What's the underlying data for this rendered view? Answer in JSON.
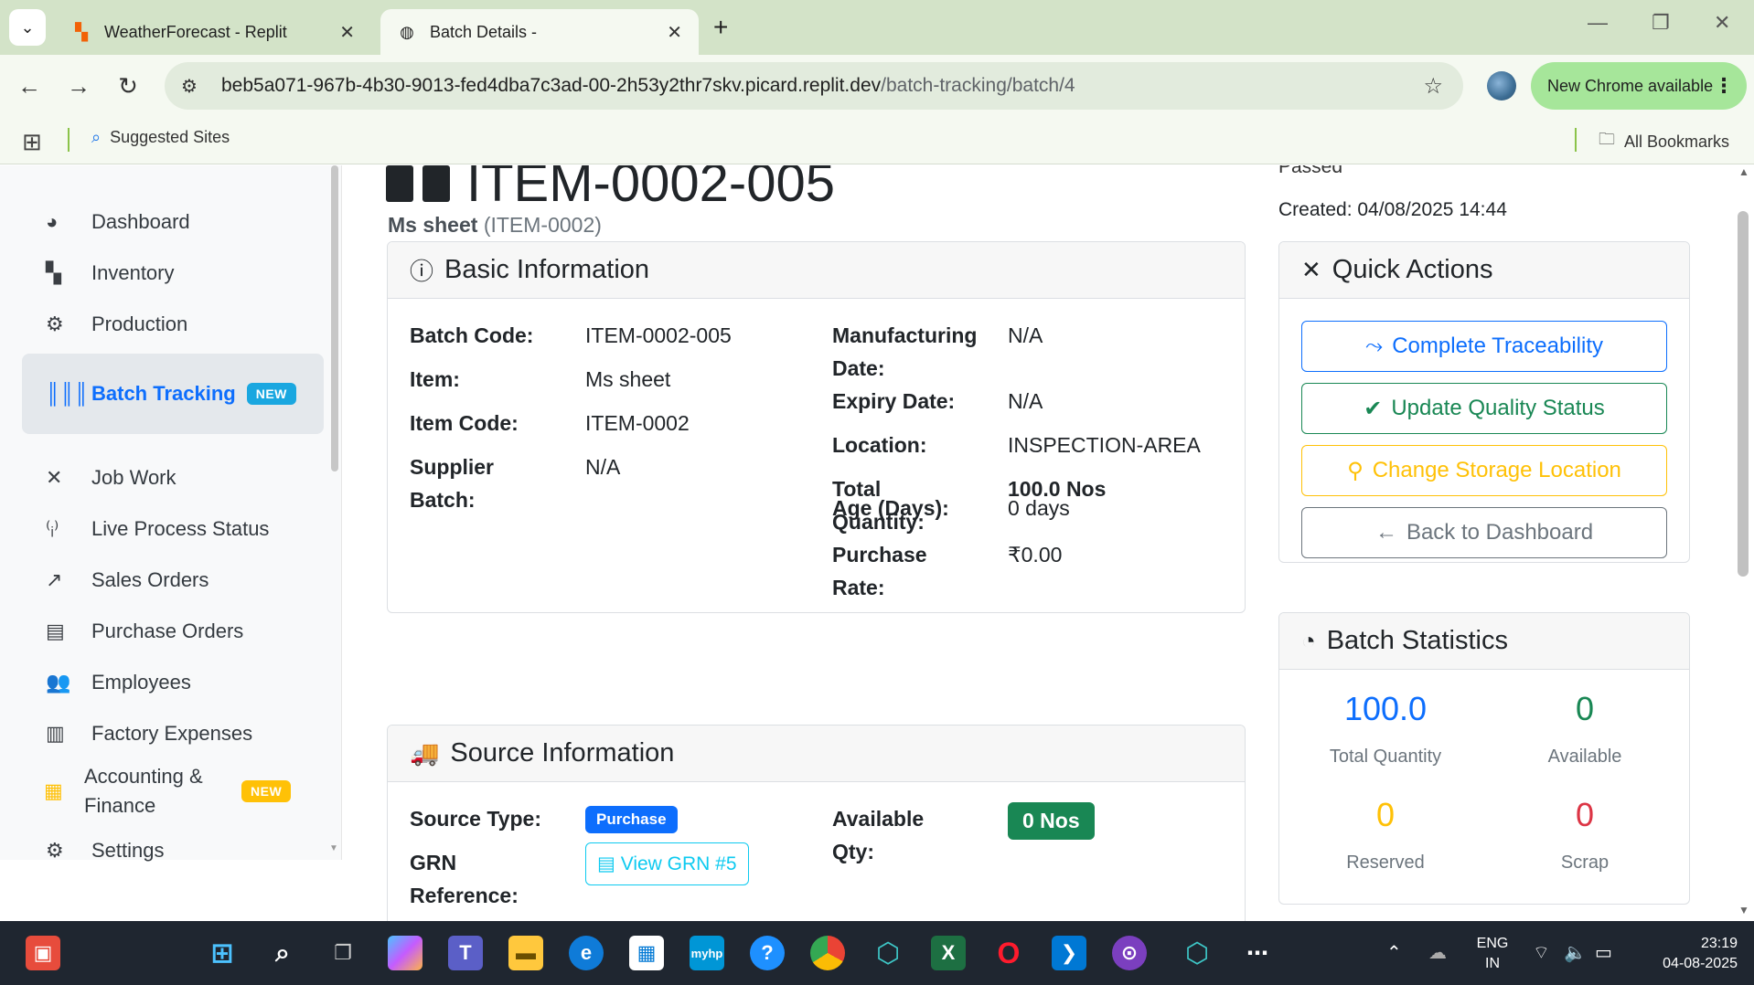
{
  "browser": {
    "tabs": [
      {
        "title": "WeatherForecast - Replit",
        "icon": "replit-icon"
      },
      {
        "title": "Batch Details -",
        "icon": "globe-icon"
      }
    ],
    "url_host": "beb5a071-967b-4b30-9013-fed4dba7c3ad-00-2h53y2thr7skv.picard.replit.dev",
    "url_path": "/batch-tracking/batch/4",
    "update_label": "New Chrome available",
    "bookmarks": {
      "suggested": "Suggested Sites",
      "all": "All Bookmarks"
    }
  },
  "sidebar": {
    "items": [
      {
        "label": "Dashboard",
        "icon": "palette-icon"
      },
      {
        "label": "Inventory",
        "icon": "boxes-icon"
      },
      {
        "label": "Production",
        "icon": "cogs-icon"
      },
      {
        "label": "Batch Tracking",
        "icon": "barcode-icon",
        "badge": "NEW",
        "active": true
      },
      {
        "label": "Job Work",
        "icon": "tools-icon"
      },
      {
        "label": "Live Process Status",
        "icon": "broadcast-icon"
      },
      {
        "label": "Sales Orders",
        "icon": "chart-line-icon"
      },
      {
        "label": "Purchase Orders",
        "icon": "file-icon"
      },
      {
        "label": "Employees",
        "icon": "users-icon"
      },
      {
        "label": "Factory Expenses",
        "icon": "receipt-icon"
      },
      {
        "label": "Accounting & Finance",
        "icon": "calculator-icon",
        "badge": "NEW"
      },
      {
        "label": "Settings",
        "icon": "gear-icon"
      }
    ]
  },
  "header": {
    "title": "ITEM-0002-005",
    "item_name": "Ms sheet",
    "item_code": "(ITEM-0002)",
    "status_partial": "Passed",
    "created": "Created: 04/08/2025 14:44"
  },
  "basic_info": {
    "heading": "Basic Information",
    "left": [
      {
        "label": "Batch Code:",
        "value": "ITEM-0002-005"
      },
      {
        "label": "Item:",
        "value": "Ms sheet"
      },
      {
        "label": "Item Code:",
        "value": "ITEM-0002"
      },
      {
        "label": "Supplier Batch:",
        "value": "N/A"
      }
    ],
    "right": [
      {
        "label": "Manufacturing Date:",
        "value": "N/A"
      },
      {
        "label": "Expiry Date:",
        "value": "N/A"
      },
      {
        "label": "Location:",
        "value": "INSPECTION-AREA"
      },
      {
        "label": "Total Quantity:",
        "value": "100.0 Nos"
      },
      {
        "label": "Purchase Rate:",
        "value": "₹0.00"
      },
      {
        "label": "Age (Days):",
        "value": "0 days"
      }
    ]
  },
  "source_info": {
    "heading": "Source Information",
    "source_type_label": "Source Type:",
    "source_type": "Purchase",
    "grn_label": "GRN Reference:",
    "grn_button": "View GRN #5",
    "available_label": "Available Qty:",
    "available_value": "0 Nos"
  },
  "quick_actions": {
    "heading": "Quick Actions",
    "buttons": [
      {
        "label": "Complete Traceability",
        "icon": "route-icon"
      },
      {
        "label": "Update Quality Status",
        "icon": "check-circle-icon"
      },
      {
        "label": "Change Storage Location",
        "icon": "map-pin-icon"
      },
      {
        "label": "Back to Dashboard",
        "icon": "arrow-left-icon"
      }
    ]
  },
  "batch_stats": {
    "heading": "Batch Statistics",
    "stats": [
      {
        "value": "100.0",
        "label": "Total Quantity",
        "color": "#0d6efd"
      },
      {
        "value": "0",
        "label": "Available",
        "color": "#198754"
      },
      {
        "value": "0",
        "label": "Reserved",
        "color": "#ffc107"
      },
      {
        "value": "0",
        "label": "Scrap",
        "color": "#dc3545"
      }
    ]
  },
  "taskbar": {
    "lang_top": "ENG",
    "lang_bottom": "IN",
    "time": "23:19",
    "date": "04-08-2025"
  }
}
